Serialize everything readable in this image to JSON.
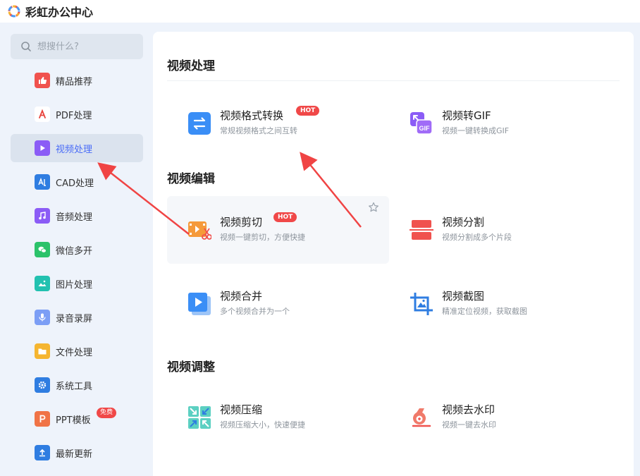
{
  "app": {
    "title": "彩虹办公中心"
  },
  "search": {
    "placeholder": "想搜什么?"
  },
  "sidebar": {
    "items": [
      {
        "label": "精品推荐",
        "icon": "thumbs-up-icon",
        "color": "#f0524e"
      },
      {
        "label": "PDF处理",
        "icon": "pdf-icon",
        "color": "#ffffff"
      },
      {
        "label": "视频处理",
        "icon": "video-play-icon",
        "color": "#8b5cf6",
        "active": true
      },
      {
        "label": "CAD处理",
        "icon": "cad-icon",
        "color": "#2f7de1"
      },
      {
        "label": "音频处理",
        "icon": "music-icon",
        "color": "#8b5cf6"
      },
      {
        "label": "微信多开",
        "icon": "wechat-icon",
        "color": "#2bc26a"
      },
      {
        "label": "图片处理",
        "icon": "image-icon",
        "color": "#22c1b0"
      },
      {
        "label": "录音录屏",
        "icon": "microphone-icon",
        "color": "#7c9ef5"
      },
      {
        "label": "文件处理",
        "icon": "folder-icon",
        "color": "#f5b530"
      },
      {
        "label": "系统工具",
        "icon": "gear-icon",
        "color": "#2f7de1"
      },
      {
        "label": "PPT模板",
        "icon": "ppt-icon",
        "color": "#f07346",
        "badge": "免费"
      },
      {
        "label": "最新更新",
        "icon": "upload-icon",
        "color": "#2f7de1"
      }
    ]
  },
  "main": {
    "sections": [
      {
        "title": "视频处理",
        "cards": [
          {
            "name": "视频格式转换",
            "desc": "常规视频格式之间互转",
            "icon": "convert-icon",
            "hot": "HOT"
          },
          {
            "name": "视频转GIF",
            "desc": "视频一键转换成GIF",
            "icon": "gif-icon",
            "icon_text": "GIF"
          }
        ]
      },
      {
        "title": "视频编辑",
        "cards": [
          {
            "name": "视频剪切",
            "desc": "视频一键剪切，方便快捷",
            "icon": "video-cut-icon",
            "hot": "HOT"
          },
          {
            "name": "视频分割",
            "desc": "视频分割成多个片段",
            "icon": "split-icon"
          },
          {
            "name": "视频合并",
            "desc": "多个视频合并为一个",
            "icon": "merge-icon"
          },
          {
            "name": "视频截图",
            "desc": "精准定位视频，获取截图",
            "icon": "crop-icon"
          }
        ]
      },
      {
        "title": "视频调整",
        "cards": [
          {
            "name": "视频压缩",
            "desc": "视频压缩大小，快速便捷",
            "icon": "compress-icon"
          },
          {
            "name": "视频去水印",
            "desc": "视频一键去水印",
            "icon": "watermark-remove-icon"
          }
        ]
      }
    ]
  },
  "colors": {
    "accent": "#4a6cf7",
    "hot": "#f04848",
    "arrow": "#f04444"
  }
}
